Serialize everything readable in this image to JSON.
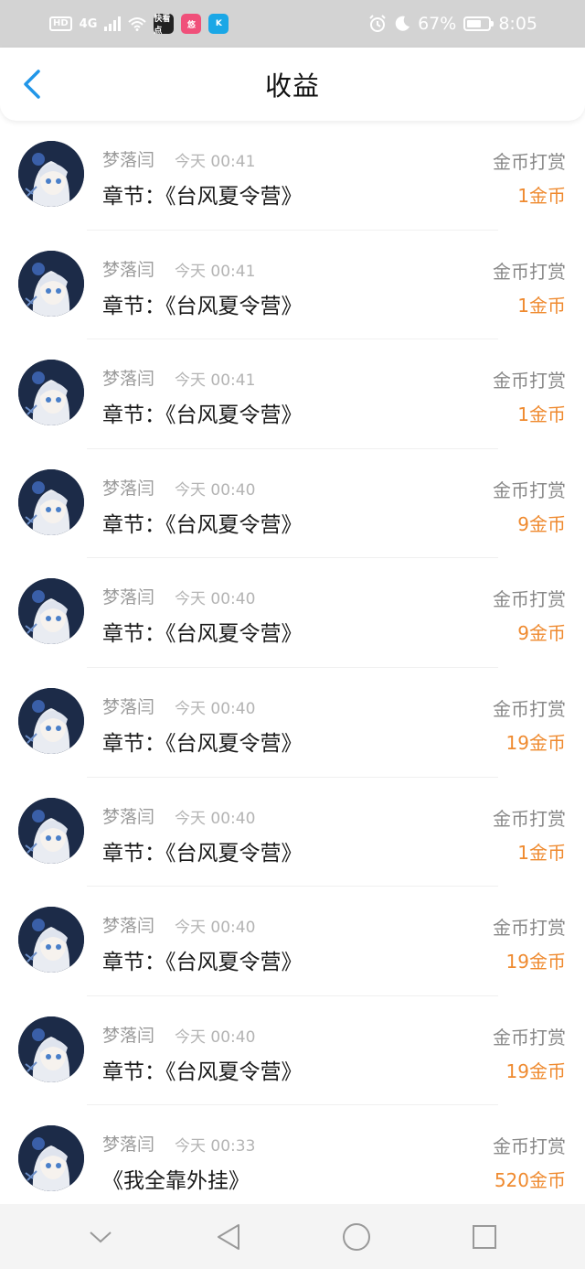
{
  "status_bar": {
    "hd": "HD",
    "network": "4G",
    "app_icons": [
      "快看点",
      "悠",
      "K"
    ],
    "battery_percent": "67%",
    "battery_level": 0.67,
    "time": "8:05"
  },
  "header": {
    "title": "收益"
  },
  "colors": {
    "accent_blue": "#2196e8",
    "amount_orange": "#ef8a2f"
  },
  "items": [
    {
      "user": "梦落闫",
      "time": "今天 00:41",
      "chapter": "章节：《台风夏令营》",
      "reward_type": "金币打赏",
      "amount": "1金币"
    },
    {
      "user": "梦落闫",
      "time": "今天 00:41",
      "chapter": "章节：《台风夏令营》",
      "reward_type": "金币打赏",
      "amount": "1金币"
    },
    {
      "user": "梦落闫",
      "time": "今天 00:41",
      "chapter": "章节：《台风夏令营》",
      "reward_type": "金币打赏",
      "amount": "1金币"
    },
    {
      "user": "梦落闫",
      "time": "今天 00:40",
      "chapter": "章节：《台风夏令营》",
      "reward_type": "金币打赏",
      "amount": "9金币"
    },
    {
      "user": "梦落闫",
      "time": "今天 00:40",
      "chapter": "章节：《台风夏令营》",
      "reward_type": "金币打赏",
      "amount": "9金币"
    },
    {
      "user": "梦落闫",
      "time": "今天 00:40",
      "chapter": "章节：《台风夏令营》",
      "reward_type": "金币打赏",
      "amount": "19金币"
    },
    {
      "user": "梦落闫",
      "time": "今天 00:40",
      "chapter": "章节：《台风夏令营》",
      "reward_type": "金币打赏",
      "amount": "1金币"
    },
    {
      "user": "梦落闫",
      "time": "今天 00:40",
      "chapter": "章节：《台风夏令营》",
      "reward_type": "金币打赏",
      "amount": "19金币"
    },
    {
      "user": "梦落闫",
      "time": "今天 00:40",
      "chapter": "章节：《台风夏令营》",
      "reward_type": "金币打赏",
      "amount": "19金币"
    },
    {
      "user": "梦落闫",
      "time": "今天 00:33",
      "chapter": "《我全靠外挂》",
      "reward_type": "金币打赏",
      "amount": "520金币"
    }
  ],
  "nav": {
    "icons": [
      "chevron-down-icon",
      "back-triangle-icon",
      "home-circle-icon",
      "recents-square-icon"
    ]
  }
}
